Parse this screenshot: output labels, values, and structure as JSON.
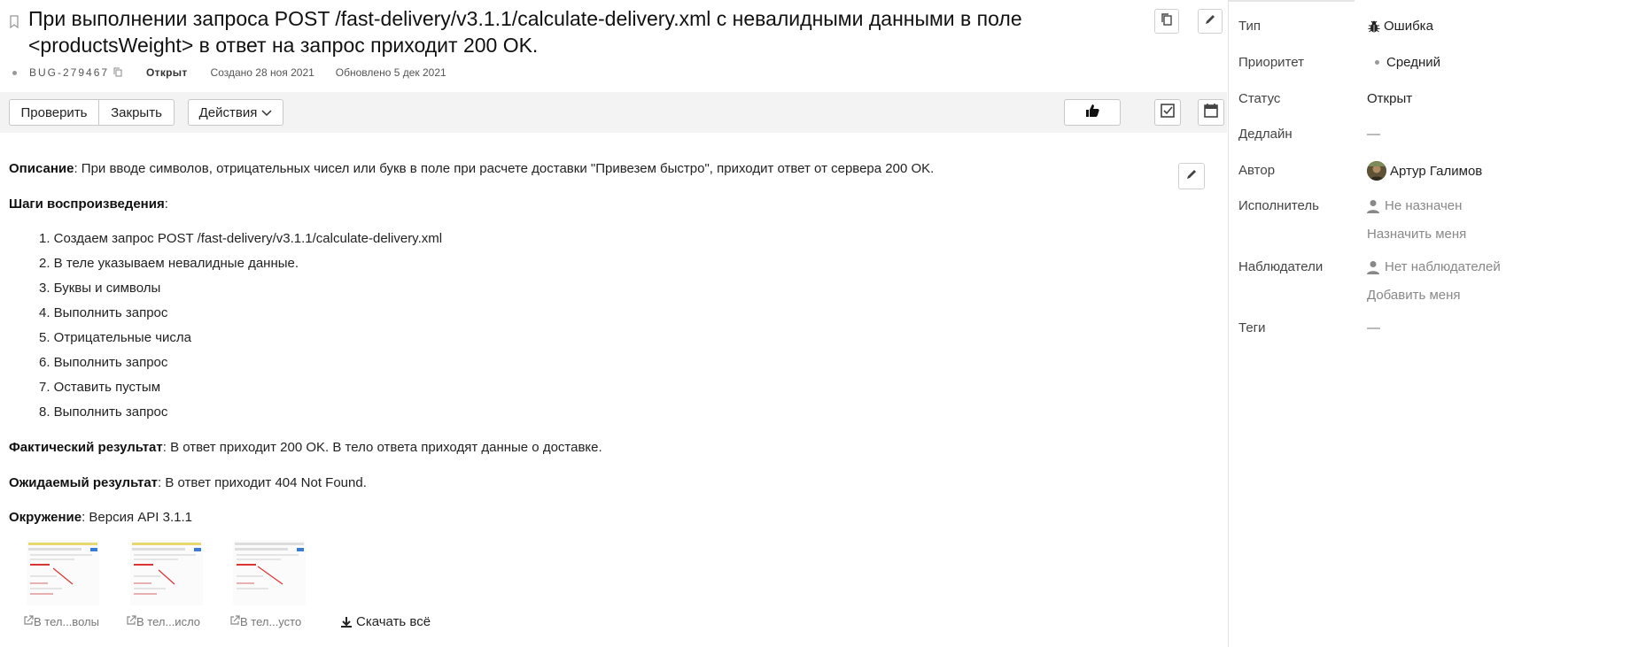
{
  "issue": {
    "title": "При выполнении запроса POST /fast-delivery/v3.1.1/calculate-delivery.xml с невалидными данными в поле <productsWeight> в ответ на запрос приходит 200 OK.",
    "key": "BUG-279467",
    "status": "Открыт",
    "created": "Создано 28 ноя 2021",
    "updated": "Обновлено 5 дек 2021"
  },
  "toolbar": {
    "check_label": "Проверить",
    "close_label": "Закрыть",
    "actions_label": "Действия"
  },
  "description": {
    "desc_label": "Описание",
    "desc_text": ": При вводе символов, отрицательных чисел или букв в поле при расчете доставки \"Привезем быстро\", приходит ответ от сервера 200 OK.",
    "steps_label": "Шаги воспроизведения",
    "steps_colon": ":",
    "steps": [
      "1. Создаем запрос POST /fast-delivery/v3.1.1/calculate-delivery.xml",
      "2. В теле указываем невалидные данные.",
      "3. Буквы и символы",
      "4. Выполнить запрос",
      "5. Отрицательные числа",
      "6. Выполнить запрос",
      "7. Оставить пустым",
      "8. Выполнить запрос"
    ],
    "actual_label": "Фактический результат",
    "actual_text": ": В ответ приходит 200 OK. В тело ответа приходят данные о доставке.",
    "expected_label": "Ожидаемый результат",
    "expected_text": ": В ответ приходит 404 Not Found.",
    "env_label": "Окружение",
    "env_text": ": Версия API 3.1.1"
  },
  "attachments": {
    "items": [
      {
        "name": "В тел...волы"
      },
      {
        "name": "В тел...исло"
      },
      {
        "name": "В тел...усто"
      }
    ],
    "download_all": "Скачать всё"
  },
  "properties": {
    "type_label": "Тип",
    "type_value": "Ошибка",
    "priority_label": "Приоритет",
    "priority_value": "Средний",
    "status_label": "Статус",
    "status_value": "Открыт",
    "deadline_label": "Дедлайн",
    "deadline_value": "—",
    "author_label": "Автор",
    "author_value": "Артур Галимов",
    "assignee_label": "Исполнитель",
    "assignee_value": "Не назначен",
    "assign_me": "Назначить меня",
    "watchers_label": "Наблюдатели",
    "watchers_value": "Нет наблюдателей",
    "add_me": "Добавить меня",
    "tags_label": "Теги",
    "tags_value": "—"
  },
  "icons": {
    "bookmark": "bookmark-icon",
    "copy": "copy-icon",
    "edit": "pencil-icon",
    "like": "thumbs-up-icon",
    "checklist": "checkbox-icon",
    "calendar": "calendar-icon",
    "bug": "bug-icon",
    "person": "person-icon",
    "download": "download-icon",
    "external": "external-link-icon"
  }
}
